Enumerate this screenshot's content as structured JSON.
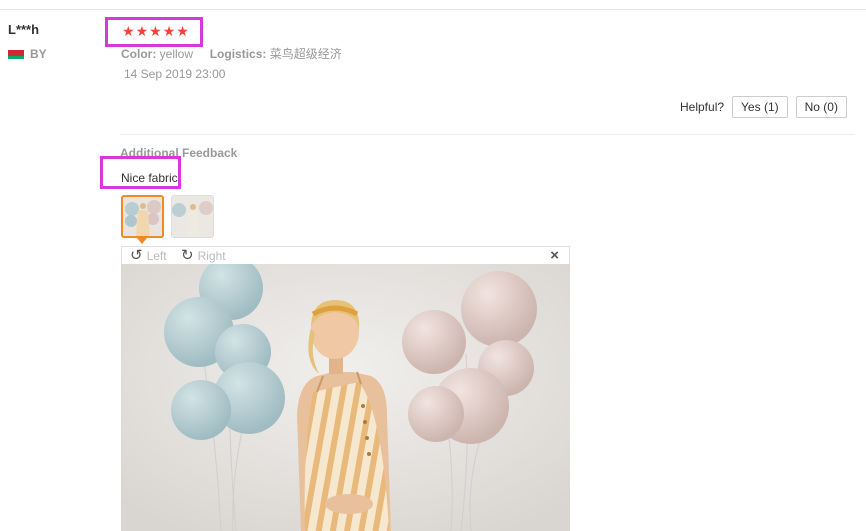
{
  "review": {
    "user": "L***h",
    "country": "BY",
    "rating": 5,
    "color_key": "Color:",
    "color_value": "yellow",
    "logistics_key": "Logistics:",
    "logistics_value": "菜鸟超级经济",
    "date": "14 Sep 2019 23:00"
  },
  "helpful": {
    "label": "Helpful?",
    "yes": "Yes (1)",
    "no": "No (0)"
  },
  "additional": {
    "title": "Additional Feedback",
    "text": "Nice fabric"
  },
  "viewer": {
    "left_label": "Left",
    "right_label": "Right",
    "thumbnails": 2,
    "selected_thumbnail": 1
  },
  "colors": {
    "star": "#f44336",
    "highlight": "#d63ad6",
    "active_thumb": "#f08a24"
  }
}
